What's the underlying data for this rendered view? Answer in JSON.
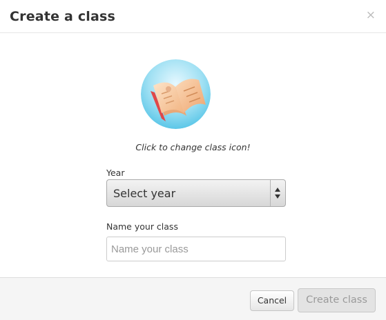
{
  "dialog": {
    "title": "Create a class",
    "close_label": "×"
  },
  "class_icon": {
    "icon": "open-book-icon",
    "caption": "Click to change class icon!"
  },
  "form": {
    "year_label": "Year",
    "year_selected": "Select year",
    "name_label": "Name your class",
    "name_placeholder": "Name your class",
    "name_value": ""
  },
  "footer": {
    "cancel_label": "Cancel",
    "create_label": "Create class"
  },
  "colors": {
    "icon_background": "#8fd8ee",
    "create_button_disabled_bg": "#e3e3e3",
    "footer_bg": "#f5f5f5"
  }
}
